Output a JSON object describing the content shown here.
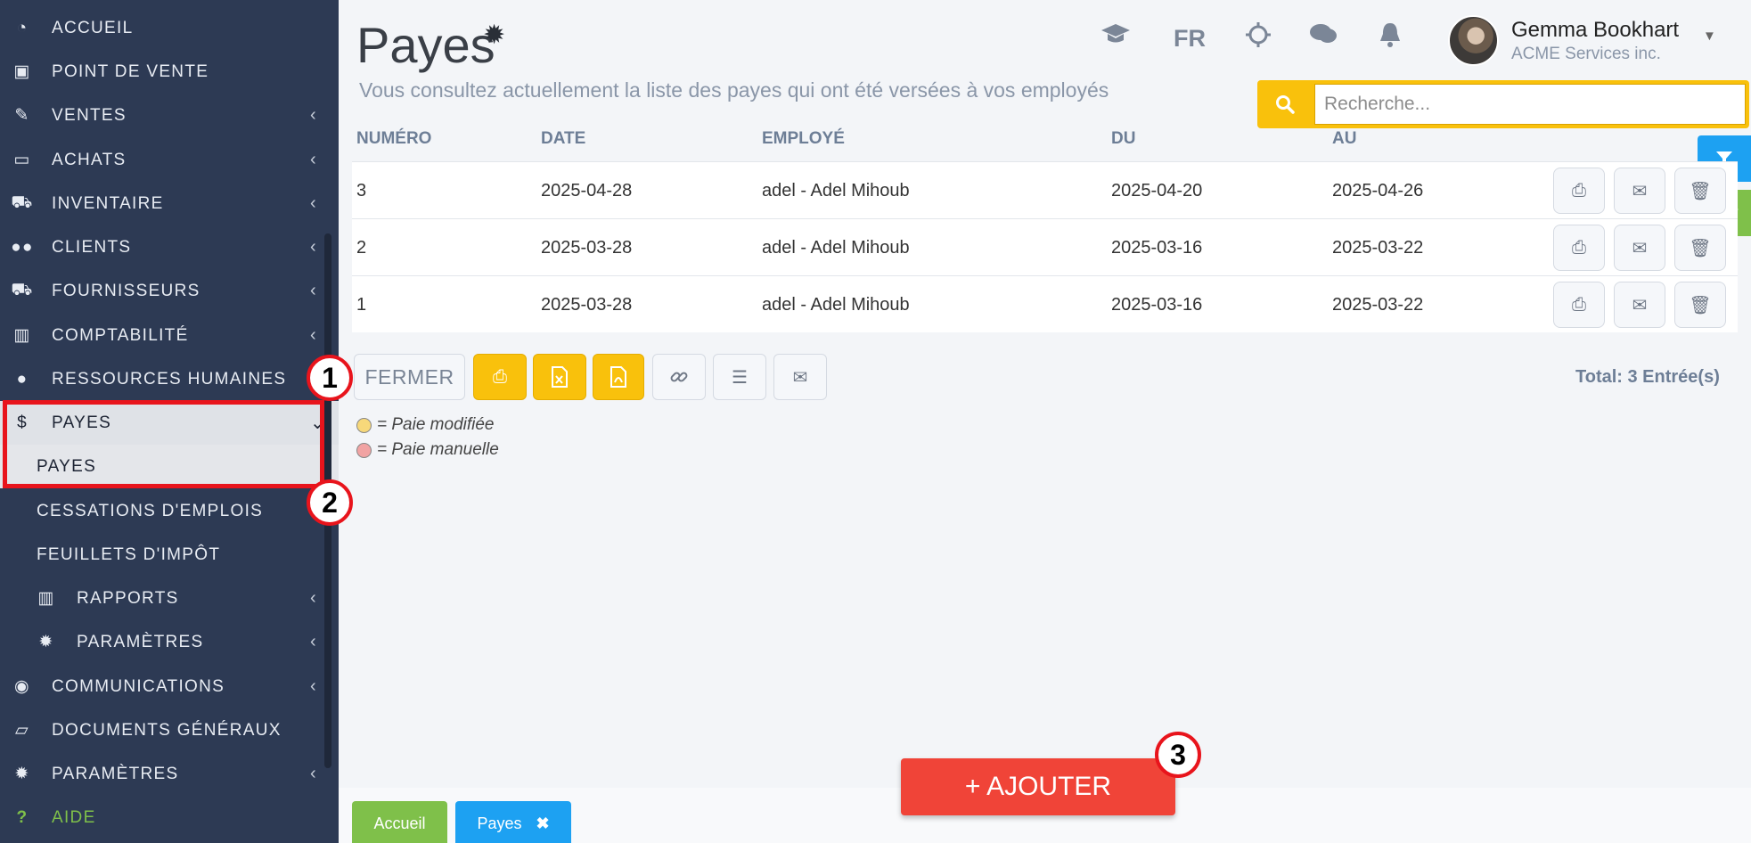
{
  "sidebar": {
    "items": [
      {
        "label": "ACCUEIL",
        "icon": "dashboard-icon"
      },
      {
        "label": "POINT DE VENTE",
        "icon": "cash-icon"
      },
      {
        "label": "VENTES",
        "icon": "edit-icon"
      },
      {
        "label": "ACHATS",
        "icon": "credit-card-icon"
      },
      {
        "label": "INVENTAIRE",
        "icon": "cart-icon"
      },
      {
        "label": "CLIENTS",
        "icon": "users-icon"
      },
      {
        "label": "FOURNISSEURS",
        "icon": "truck-icon"
      },
      {
        "label": "COMPTABILITÉ",
        "icon": "bar-chart-icon"
      },
      {
        "label": "RESSOURCES HUMAINES",
        "icon": "user-icon"
      },
      {
        "label": "PAYES",
        "icon": "dollar-icon"
      },
      {
        "label": "PAYES"
      },
      {
        "label": "CESSATIONS D'EMPLOIS"
      },
      {
        "label": "FEUILLETS D'IMPÔT"
      },
      {
        "label": "RAPPORTS",
        "icon": "bar-chart-icon"
      },
      {
        "label": "PARAMÈTRES",
        "icon": "gear-icon"
      },
      {
        "label": "COMMUNICATIONS",
        "icon": "chat-icon"
      },
      {
        "label": "DOCUMENTS GÉNÉRAUX",
        "icon": "folder-icon"
      },
      {
        "label": "PARAMÈTRES",
        "icon": "gear-icon"
      },
      {
        "label": "AIDE",
        "icon": "question-icon"
      }
    ]
  },
  "markers": [
    "1",
    "2",
    "3"
  ],
  "header": {
    "title": "Payes",
    "subtitle": "Vous consultez actuellement la liste des payes qui ont été versées à vos employés",
    "lang": "FR",
    "user_name": "Gemma Bookhart",
    "user_org": "ACME Services inc."
  },
  "search": {
    "placeholder": "Recherche..."
  },
  "table": {
    "headers": [
      "NUMÉRO",
      "DATE",
      "EMPLOYÉ",
      "DU",
      "AU"
    ],
    "rows": [
      {
        "numero": "3",
        "date": "2025-04-28",
        "employe": "adel - Adel Mihoub",
        "du": "2025-04-20",
        "au": "2025-04-26"
      },
      {
        "numero": "2",
        "date": "2025-03-28",
        "employe": "adel - Adel Mihoub",
        "du": "2025-03-16",
        "au": "2025-03-22"
      },
      {
        "numero": "1",
        "date": "2025-03-28",
        "employe": "adel - Adel Mihoub",
        "du": "2025-03-16",
        "au": "2025-03-22"
      }
    ]
  },
  "toolbar": {
    "close_label": "FERMER",
    "total": "Total: 3 Entrée(s)"
  },
  "legend": {
    "modified": "= Paie modifiée",
    "manual": "= Paie manuelle",
    "modified_color": "#f7d87a",
    "manual_color": "#f1a3a3"
  },
  "footer": {
    "add_label": "+ AJOUTER",
    "tab_home": "Accueil",
    "tab_payes": "Payes"
  },
  "colors": {
    "sidebar_bg": "#2d3a54",
    "accent_yellow": "#f9c10c",
    "add_red": "#f04438",
    "filter_blue": "#1da1f2",
    "help_green": "#7fc04a"
  }
}
